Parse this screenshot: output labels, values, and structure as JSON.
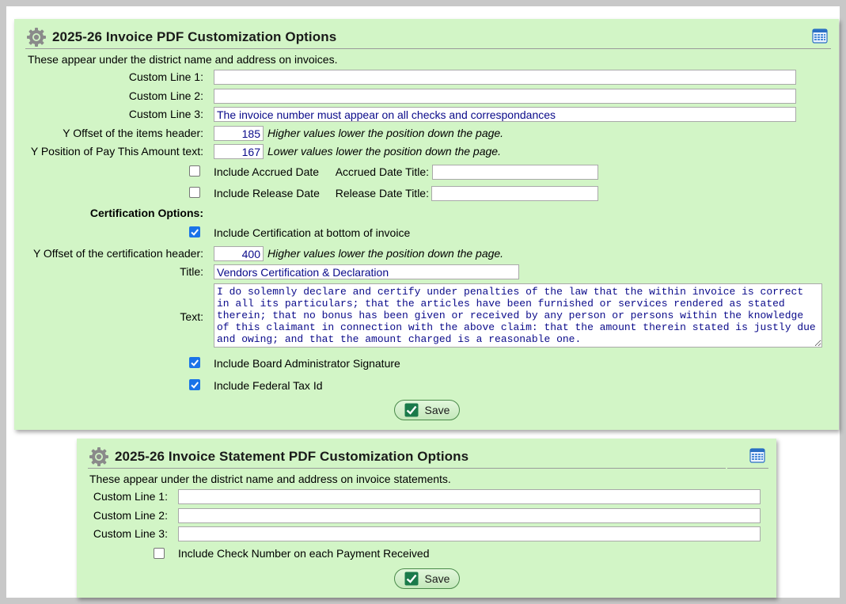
{
  "panel1": {
    "title": "2025-26 Invoice PDF Customization Options",
    "note": "These appear under the district name and address on invoices.",
    "custom_line_1": {
      "label": "Custom Line 1:",
      "value": ""
    },
    "custom_line_2": {
      "label": "Custom Line 2:",
      "value": ""
    },
    "custom_line_3": {
      "label": "Custom Line 3:",
      "value": "The invoice number must appear on all checks and correspondances"
    },
    "items_header_offset": {
      "label": "Y Offset of the items header:",
      "value": "185",
      "hint": "Higher values lower the position down the page."
    },
    "pay_amount_position": {
      "label": "Y Position of Pay This Amount text:",
      "value": "167",
      "hint": "Lower values lower the position down the page."
    },
    "accrued_date": {
      "label": "Include Accrued Date",
      "checked": false,
      "title_label": "Accrued Date Title:",
      "title_value": ""
    },
    "release_date": {
      "label": "Include Release Date",
      "checked": false,
      "title_label": "Release Date Title:",
      "title_value": ""
    },
    "certification_heading": "Certification Options:",
    "include_certification": {
      "label": "Include Certification at bottom of invoice",
      "checked": true
    },
    "certification_offset": {
      "label": "Y Offset of the certification header:",
      "value": "400",
      "hint": "Higher values lower the position down the page."
    },
    "cert_title": {
      "label": "Title:",
      "value": "Vendors Certification & Declaration"
    },
    "cert_text": {
      "label": "Text:",
      "value": "I do solemnly declare and certify under penalties of the law that the within invoice is correct in all its particulars; that the articles have been furnished or services rendered as stated therein; that no bonus has been given or received by any person or persons within the knowledge of this claimant in connection with the above claim: that the amount therein stated is justly due and owing; and that the amount charged is a reasonable one."
    },
    "board_signature": {
      "label": "Include Board Administrator Signature",
      "checked": true
    },
    "federal_tax_id": {
      "label": "Include Federal Tax Id",
      "checked": true
    },
    "save_label": "Save"
  },
  "panel2": {
    "title": "2025-26 Invoice Statement PDF Customization Options",
    "note": "These appear under the district name and address on invoice statements.",
    "custom_line_1": {
      "label": "Custom Line 1:",
      "value": ""
    },
    "custom_line_2": {
      "label": "Custom Line 2:",
      "value": ""
    },
    "custom_line_3": {
      "label": "Custom Line 3:",
      "value": ""
    },
    "check_number": {
      "label": "Include Check Number on each Payment Received",
      "checked": false
    },
    "save_label": "Save"
  },
  "colors": {
    "panel_bg": "#d2f5c6",
    "checkbox_accent": "#1a73e8",
    "input_text": "#0a0a8a",
    "save_check": "#1a7a4a"
  },
  "icons": {
    "header_left": "gear-icon",
    "header_right": "calendar-icon",
    "save": "checkmark-icon"
  }
}
